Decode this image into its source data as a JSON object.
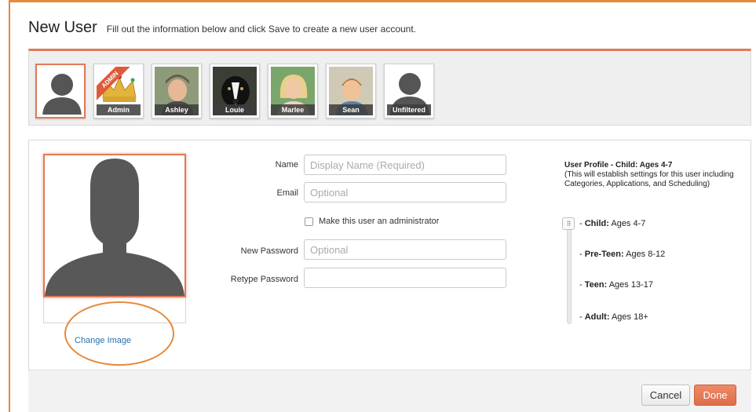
{
  "header": {
    "title": "New User",
    "subtitle": "Fill out the information below and click Save to create a new user account."
  },
  "avatars": [
    {
      "label": "",
      "selected": true,
      "icon": "silhouette-icon"
    },
    {
      "label": "Admin",
      "badge": "ADMIN",
      "icon": "crown-icon"
    },
    {
      "label": "Ashley",
      "icon": "photo-ashley"
    },
    {
      "label": "Louie",
      "icon": "photo-dog"
    },
    {
      "label": "Marlee",
      "icon": "photo-marlee"
    },
    {
      "label": "Sean",
      "icon": "photo-sean"
    },
    {
      "label": "Unfiltered",
      "icon": "silhouette-icon"
    }
  ],
  "profile_image": {
    "change_label": "Change Image"
  },
  "form": {
    "name_label": "Name",
    "name_placeholder": "Display Name (Required)",
    "email_label": "Email",
    "email_placeholder": "Optional",
    "admin_checkbox_label": "Make this user an administrator",
    "new_password_label": "New Password",
    "new_password_placeholder": "Optional",
    "retype_password_label": "Retype Password",
    "retype_password_placeholder": ""
  },
  "user_profile": {
    "heading": "User Profile - Child: Ages 4-7",
    "description": "(This will establish settings for this user including Categories, Applications, and Scheduling)",
    "options": [
      {
        "name": "Child:",
        "ages": "Ages 4-7",
        "selected": true
      },
      {
        "name": "Pre-Teen:",
        "ages": "Ages 8-12"
      },
      {
        "name": "Teen:",
        "ages": "Ages 13-17"
      },
      {
        "name": "Adult:",
        "ages": "Ages 18+"
      }
    ]
  },
  "buttons": {
    "cancel": "Cancel",
    "done": "Done"
  },
  "colors": {
    "accent": "#e07a5a",
    "frame": "#e58a3a",
    "link": "#2a6fb5"
  }
}
